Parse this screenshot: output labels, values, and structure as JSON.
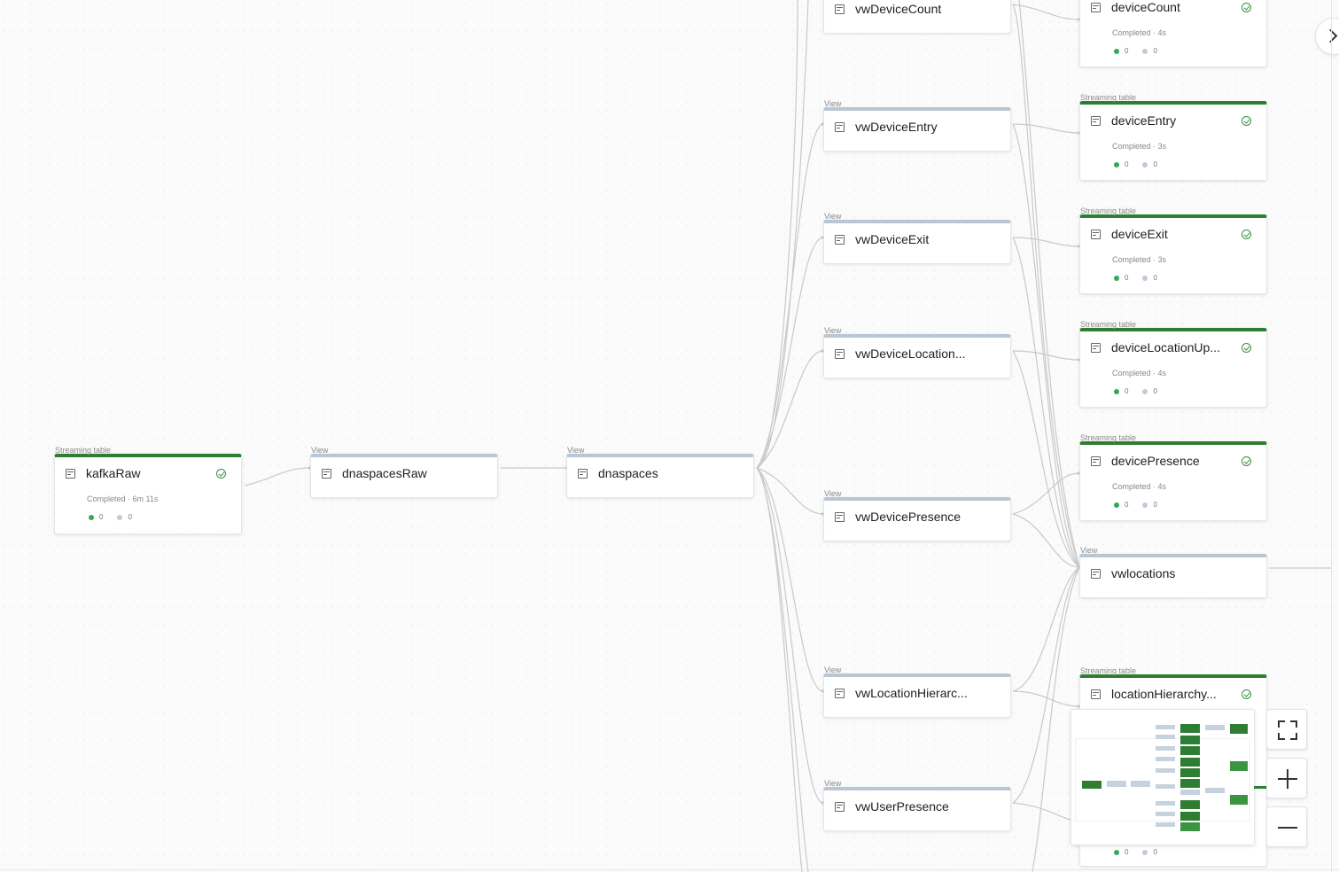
{
  "graph": {
    "nodes": {
      "kafkaRaw": {
        "type": "Streaming table",
        "name": "kafkaRaw",
        "status": "Completed · 6m 11s",
        "m1": "0",
        "m2": "0"
      },
      "dnaspacesRaw": {
        "type": "View",
        "name": "dnaspacesRaw"
      },
      "dnaspaces": {
        "type": "View",
        "name": "dnaspaces"
      },
      "vwDeviceCount": {
        "name": "vwDeviceCount"
      },
      "vwDeviceEntry": {
        "type": "View",
        "name": "vwDeviceEntry"
      },
      "vwDeviceExit": {
        "type": "View",
        "name": "vwDeviceExit"
      },
      "vwDeviceLocation": {
        "type": "View",
        "name": "vwDeviceLocation..."
      },
      "vwDevicePresence": {
        "type": "View",
        "name": "vwDevicePresence"
      },
      "vwLocationHierarc": {
        "type": "View",
        "name": "vwLocationHierarc..."
      },
      "vwUserPresence": {
        "type": "View",
        "name": "vwUserPresence"
      },
      "deviceCount": {
        "name": "deviceCount",
        "status": "Completed · 4s",
        "m1": "0",
        "m2": "0"
      },
      "deviceEntry": {
        "type": "Streaming table",
        "name": "deviceEntry",
        "status": "Completed · 3s",
        "m1": "0",
        "m2": "0"
      },
      "deviceExit": {
        "type": "Streaming table",
        "name": "deviceExit",
        "status": "Completed · 3s",
        "m1": "0",
        "m2": "0"
      },
      "deviceLocationUp": {
        "type": "Streaming table",
        "name": "deviceLocationUp...",
        "status": "Completed · 4s",
        "m1": "0",
        "m2": "0"
      },
      "devicePresence": {
        "type": "Streaming table",
        "name": "devicePresence",
        "status": "Completed · 4s",
        "m1": "0",
        "m2": "0"
      },
      "vwlocations": {
        "type": "View",
        "name": "vwlocations"
      },
      "locationHierarchy": {
        "type": "Streaming table",
        "name": "locationHierarchy...",
        "m1": "0",
        "m2": "0"
      }
    }
  },
  "colors": {
    "streaming_accent": "#2e7d32",
    "view_accent": "#b9c6d3",
    "edge": "#c9c9c9",
    "metric_green": "#34a853"
  },
  "controls": {
    "fit": "fit-to-screen-icon",
    "zoom_in": "plus-icon",
    "zoom_out": "minus-icon",
    "collapse": "chevron-right-icon"
  }
}
